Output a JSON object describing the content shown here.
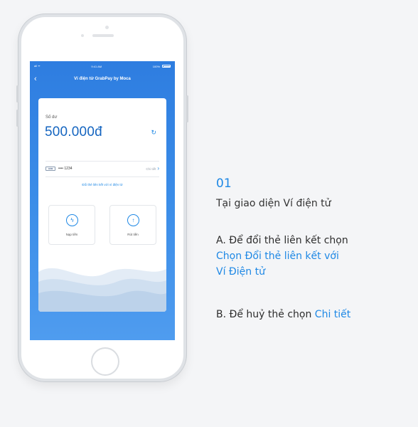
{
  "phone": {
    "status_left": "all ᯤ",
    "status_time": "9:41 AM",
    "status_battery": "100%",
    "nav_title": "Ví điện tử GrabPay by Moca",
    "balance_label": "Số dư",
    "balance_amount": "500.000đ",
    "bank_badge": "ACB",
    "account_number": "•••• 1234",
    "detail_link": "Chi tiết",
    "change_card_link": "Đổi thẻ liên kết với ví điện tử",
    "topup_label": "Nạp tiền",
    "withdraw_label": "Rút tiền"
  },
  "copy": {
    "step_number": "01",
    "subtitle": "Tại giao diện Ví điện tử",
    "section_a_heading": "A. Để đổi thẻ liên kết chọn",
    "section_a_link_line1": "Chọn Đổi thẻ liên kết với",
    "section_a_link_line2": "Ví Điện tử",
    "section_b_prefix": "B. Để huỷ thẻ chọn ",
    "section_b_link": "Chi tiết"
  },
  "colors": {
    "accent": "#1e88e5",
    "screen_blue": "#2e7de0",
    "balance_blue": "#1565c0"
  },
  "icons": [
    "back-chevron-icon",
    "refresh-icon",
    "chevron-right-icon",
    "topup-bolt-icon",
    "withdraw-arrow-icon"
  ]
}
